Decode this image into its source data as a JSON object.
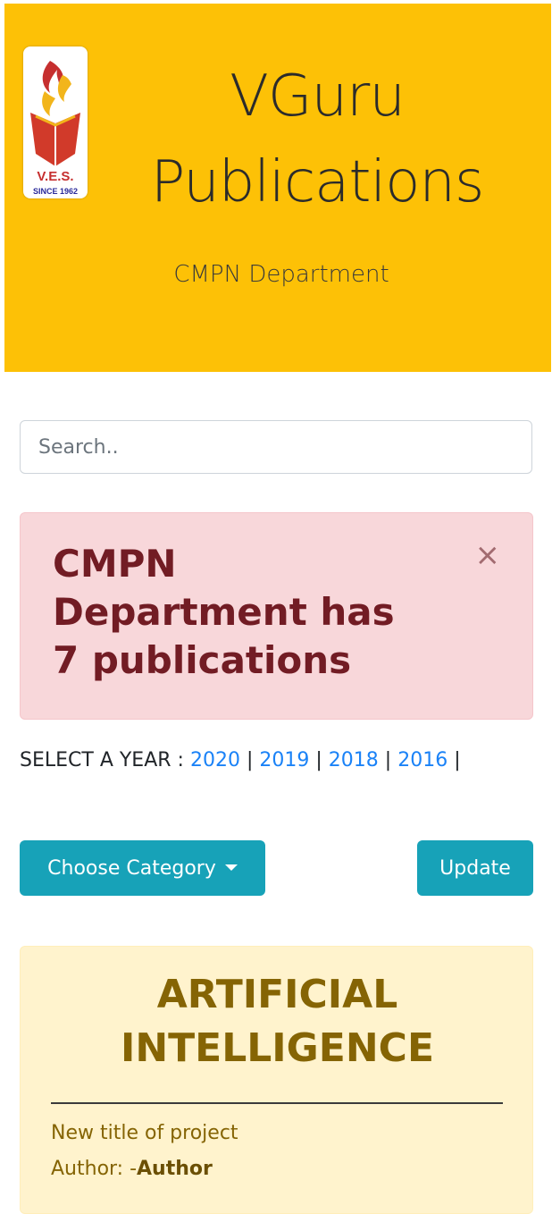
{
  "header": {
    "logo": {
      "icon": "ves-flame-book-logo",
      "text": "V.E.S.",
      "since": "SINCE 1962"
    },
    "title_line1": "VGuru",
    "title_line2": "Publications",
    "subtitle": "CMPN Department"
  },
  "search": {
    "placeholder": "Search.."
  },
  "alert": {
    "line1": "CMPN",
    "line2": "Department has",
    "line3": "7 publications",
    "close": "×"
  },
  "years": {
    "label": "SELECT A YEAR :",
    "items": [
      "2020",
      "2019",
      "2018",
      "2016"
    ],
    "separator": "|"
  },
  "buttons": {
    "category": "Choose Category",
    "update": "Update"
  },
  "card": {
    "title_line1": "ARTIFICIAL",
    "title_line2": "INTELLIGENCE",
    "project_title": "New title of project",
    "author_label": "Author: -",
    "author_name": "Author"
  },
  "colors": {
    "header_bg": "#fdc106",
    "alert_bg": "#f8d7da",
    "alert_text": "#721c24",
    "link": "#1a82f7",
    "button": "#17a2b8",
    "card_bg": "#fff3cd",
    "card_text": "#856404"
  }
}
